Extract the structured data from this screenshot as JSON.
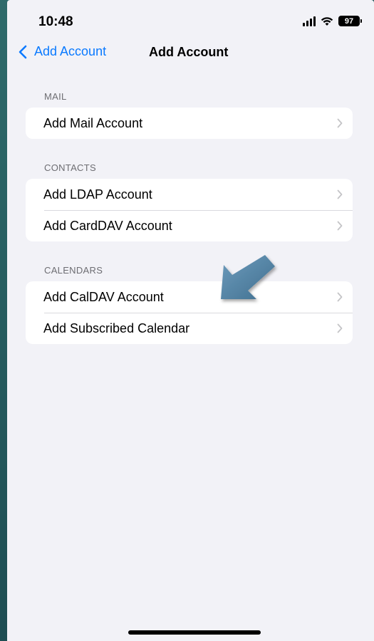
{
  "status_bar": {
    "time": "10:48",
    "battery": "97",
    "icons": [
      "signal-icon",
      "wifi-icon",
      "battery-icon"
    ]
  },
  "nav": {
    "back_label": "Add Account",
    "title": "Add Account",
    "accent_color": "#0a7aff"
  },
  "sections": [
    {
      "header": "MAIL",
      "rows": [
        {
          "label": "Add Mail Account"
        }
      ]
    },
    {
      "header": "CONTACTS",
      "rows": [
        {
          "label": "Add LDAP Account"
        },
        {
          "label": "Add CardDAV Account"
        }
      ]
    },
    {
      "header": "CALENDARS",
      "rows": [
        {
          "label": "Add CalDAV Account"
        },
        {
          "label": "Add Subscribed Calendar"
        }
      ]
    }
  ],
  "annotation": {
    "icon": "pointer-arrow-icon",
    "color": "#4f7f9f"
  },
  "colors": {
    "background": "#f2f2f7",
    "cell": "#ffffff",
    "section_header": "#6d6d72"
  }
}
